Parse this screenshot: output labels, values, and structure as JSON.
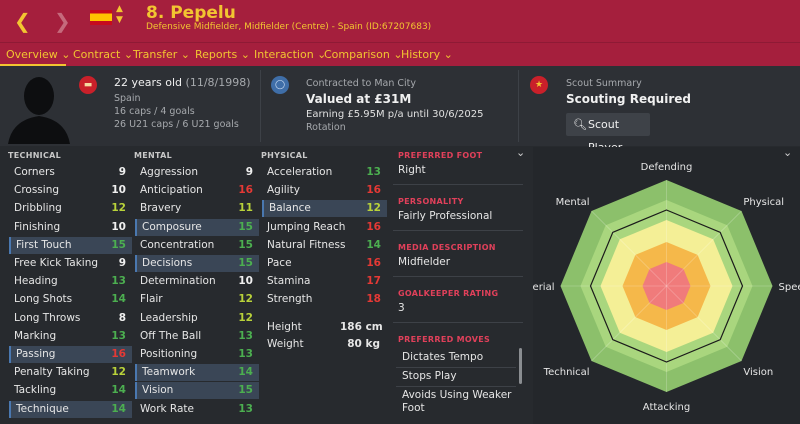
{
  "header": {
    "back_icon": "chevron-left-icon",
    "name": "8. Pepelu",
    "subtitle": "Defensive Midfielder, Midfielder (Centre) - Spain (ID:67207683)"
  },
  "nav": {
    "tabs": [
      "Overview",
      "Contract",
      "Transfer",
      "Reports",
      "Interaction",
      "Comparison",
      "History"
    ],
    "active": "Overview"
  },
  "summary": {
    "age": "22 years old",
    "dob": "(11/8/1998)",
    "nation": "Spain",
    "caps": "16 caps / 4 goals",
    "u21": "26 U21 caps / 6 U21 goals",
    "contract_label": "Contracted to Man City",
    "value": "Valued at £31M",
    "earning": "Earning £5.95M p/a until 30/6/2025",
    "squad_status": "Rotation",
    "scout_label": "Scout Summary",
    "scout_status": "Scouting Required",
    "scout_button": "Scout Player"
  },
  "colors": {
    "header_bg": "#a51f3d",
    "accent_yellow": "#f2c531",
    "high": "#4caf50",
    "mid": "#b9d23a",
    "low": "#e53935"
  },
  "technical": {
    "title": "TECHNICAL",
    "rows": [
      {
        "name": "Corners",
        "val": "9"
      },
      {
        "name": "Crossing",
        "val": "10"
      },
      {
        "name": "Dribbling",
        "val": "12"
      },
      {
        "name": "Finishing",
        "val": "10"
      },
      {
        "name": "First Touch",
        "val": "15"
      },
      {
        "name": "Free Kick Taking",
        "val": "9"
      },
      {
        "name": "Heading",
        "val": "13"
      },
      {
        "name": "Long Shots",
        "val": "14"
      },
      {
        "name": "Long Throws",
        "val": "8"
      },
      {
        "name": "Marking",
        "val": "13"
      },
      {
        "name": "Passing",
        "val": "16"
      },
      {
        "name": "Penalty Taking",
        "val": "12"
      },
      {
        "name": "Tackling",
        "val": "14"
      },
      {
        "name": "Technique",
        "val": "14"
      }
    ]
  },
  "mental": {
    "title": "MENTAL",
    "rows": [
      {
        "name": "Aggression",
        "val": "9"
      },
      {
        "name": "Anticipation",
        "val": "16"
      },
      {
        "name": "Bravery",
        "val": "11"
      },
      {
        "name": "Composure",
        "val": "15"
      },
      {
        "name": "Concentration",
        "val": "15"
      },
      {
        "name": "Decisions",
        "val": "15"
      },
      {
        "name": "Determination",
        "val": "10"
      },
      {
        "name": "Flair",
        "val": "12"
      },
      {
        "name": "Leadership",
        "val": "12"
      },
      {
        "name": "Off The Ball",
        "val": "13"
      },
      {
        "name": "Positioning",
        "val": "13"
      },
      {
        "name": "Teamwork",
        "val": "14"
      },
      {
        "name": "Vision",
        "val": "15"
      },
      {
        "name": "Work Rate",
        "val": "13"
      }
    ]
  },
  "physical": {
    "title": "PHYSICAL",
    "rows": [
      {
        "name": "Acceleration",
        "val": "13"
      },
      {
        "name": "Agility",
        "val": "16"
      },
      {
        "name": "Balance",
        "val": "12"
      },
      {
        "name": "Jumping Reach",
        "val": "16"
      },
      {
        "name": "Natural Fitness",
        "val": "14"
      },
      {
        "name": "Pace",
        "val": "16"
      },
      {
        "name": "Stamina",
        "val": "17"
      },
      {
        "name": "Strength",
        "val": "18"
      }
    ],
    "height_label": "Height",
    "height": "186 cm",
    "weight_label": "Weight",
    "weight": "80 kg"
  },
  "info": {
    "foot_label": "PREFERRED FOOT",
    "foot": "Right",
    "personality_label": "PERSONALITY",
    "personality": "Fairly Professional",
    "media_label": "MEDIA DESCRIPTION",
    "media": "Midfielder",
    "gk_label": "GOALKEEPER RATING",
    "gk": "3",
    "moves_label": "PREFERRED MOVES",
    "moves": [
      "Dictates Tempo",
      "Stops Play",
      "Avoids Using Weaker Foot"
    ]
  },
  "radar": {
    "axes": [
      "Defending",
      "Physical",
      "Speed",
      "Vision",
      "Attacking",
      "Technical",
      "Aerial",
      "Mental"
    ]
  }
}
